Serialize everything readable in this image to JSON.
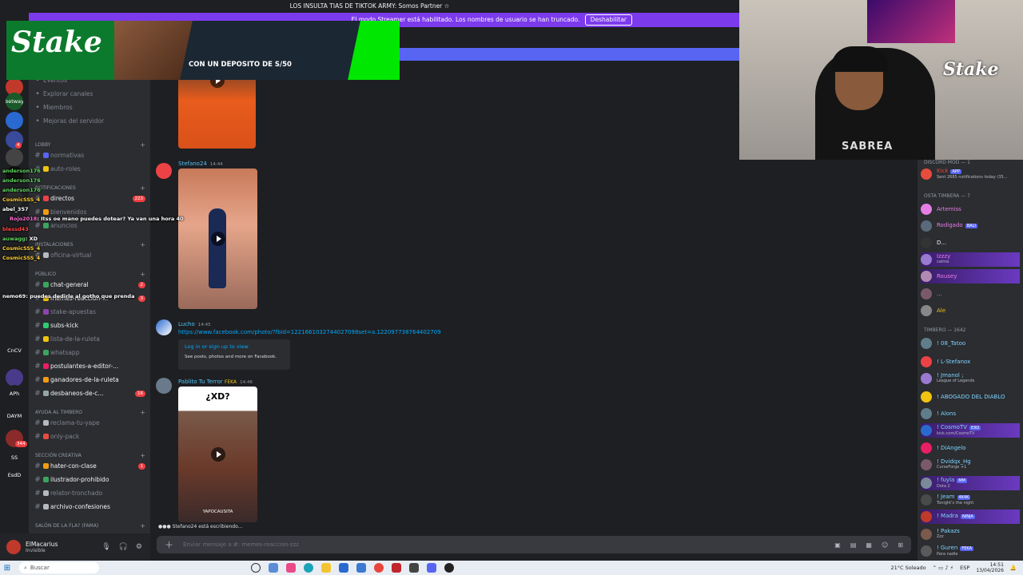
{
  "window": {
    "title": "LOS INSULTA TIAS DE TIKTOK ARMY: Somos Partner ☆"
  },
  "streamer_banner": {
    "text": "El modo Streamer está habilitado. Los nombres de usuario se han truncado.",
    "button": "Deshabilitar"
  },
  "ad": {
    "brand": "Stake",
    "promo": "CON UN DEPOSITO DE S/50"
  },
  "camera": {
    "brand": "Stake",
    "shirt": "SABREA"
  },
  "guilds": [
    {
      "label": "",
      "badge": ""
    },
    {
      "label": "betway",
      "badge": ""
    },
    {
      "label": "",
      "badge": ""
    },
    {
      "label": "",
      "badge": "4"
    },
    {
      "label": "",
      "badge": ""
    },
    {
      "label": "",
      "badge": ""
    },
    {
      "label": "",
      "badge": ""
    },
    {
      "label": "CnCV",
      "badge": ""
    },
    {
      "label": "",
      "badge": ""
    },
    {
      "label": "APh",
      "badge": ""
    },
    {
      "label": "DAYM",
      "badge": ""
    },
    {
      "label": "",
      "badge": "344"
    },
    {
      "label": "SS",
      "badge": ""
    },
    {
      "label": "EsdD",
      "badge": ""
    }
  ],
  "sidebar": {
    "top_items": [
      "Eventos",
      "Explorar canales",
      "Miembros",
      "Mejoras del servidor"
    ],
    "categories": {
      "lobby": "LOBBY",
      "notificaciones": "NOTIFICACIONES",
      "instalaciones": "INSTALACIONES",
      "publico": "PÚBLICO",
      "ayuda": "AYUDA AL TIMBERO",
      "creativa": "SECCIÓN CREATIVA",
      "salon": "SALÓN DE LA FLA? (FAMA)"
    },
    "channels": [
      {
        "name": "normativas",
        "bold": false,
        "badge": ""
      },
      {
        "name": "auto-roles",
        "bold": false,
        "badge": ""
      },
      {
        "name": "directos",
        "bold": true,
        "badge": "223"
      },
      {
        "name": "bienvenidos",
        "bold": false,
        "badge": ""
      },
      {
        "name": "anuncios",
        "bold": false,
        "badge": ""
      },
      {
        "name": "oficina-virtual",
        "bold": false,
        "badge": ""
      },
      {
        "name": "chat-general",
        "bold": true,
        "badge": "2"
      },
      {
        "name": "memes-reaccion-...",
        "bold": true,
        "badge": "3"
      },
      {
        "name": "stake-apuestas",
        "bold": false,
        "badge": ""
      },
      {
        "name": "subs-kick",
        "bold": true,
        "badge": ""
      },
      {
        "name": "lista-de-la-ruleta",
        "bold": false,
        "badge": ""
      },
      {
        "name": "whatsapp",
        "bold": false,
        "badge": ""
      },
      {
        "name": "postulantes-a-editor-...",
        "bold": true,
        "badge": ""
      },
      {
        "name": "ganadores-de-la-ruleta",
        "bold": true,
        "badge": ""
      },
      {
        "name": "desbaneos-de-c...",
        "bold": true,
        "badge": "16"
      },
      {
        "name": "reclama-tu-yape",
        "bold": false,
        "badge": ""
      },
      {
        "name": "only-pack",
        "bold": false,
        "badge": ""
      },
      {
        "name": "hater-con-clase",
        "bold": true,
        "badge": "1"
      },
      {
        "name": "ilustrador-prohibido",
        "bold": true,
        "badge": ""
      },
      {
        "name": "relator-tronchado",
        "bold": false,
        "badge": ""
      },
      {
        "name": "archivo-confesiones",
        "bold": true,
        "badge": ""
      }
    ]
  },
  "chat_overlay": [
    {
      "user": "anderson176",
      "text": "",
      "color": "#5fd35f"
    },
    {
      "user": "anderson176",
      "text": "",
      "color": "#5fd35f"
    },
    {
      "user": "anderson176",
      "text": "",
      "color": "#5fd35f"
    },
    {
      "user": "CosmicSSS_4",
      "text": "",
      "color": "#ffcc33"
    },
    {
      "user": "abel_357",
      "text": "",
      "color": "#ffffff"
    },
    {
      "user": "Rojo2018",
      "text": "Itss oe mano puedes dotear? Ya van una hora 40",
      "color": "#ff6bd6"
    },
    {
      "user": "blessd43",
      "text": "",
      "color": "#ff4444"
    },
    {
      "user": "auwagg",
      "text": "XD",
      "color": "#5fd35f"
    },
    {
      "user": "CosmicSSS_4",
      "text": "",
      "color": "#ffcc33"
    },
    {
      "user": "CosmicSSS_4",
      "text": "",
      "color": "#ffcc33"
    },
    {
      "user": "nemo69",
      "text": "puedes dedirle al gotho que prenda",
      "color": "#ffffff"
    }
  ],
  "user": {
    "name": "ElMacarius",
    "status": "Invisible"
  },
  "messages": [
    {
      "author": "Stefano24",
      "time": "14:44",
      "color": "#4fc3f7"
    },
    {
      "author": "Lucho",
      "time": "14:45",
      "color": "#4fc3f7",
      "link": "https://www.facebook.com/photo/?fbid=1221661032744027098set=a.122097738764402709",
      "embed_title": "Log in or sign up to view",
      "embed_desc": "See posts, photos and more on Facebook."
    },
    {
      "author": "Pablito Tu Terror",
      "time": "14:46",
      "color": "#4fc3f7",
      "tag": "FEKA",
      "thumb_text": "¿XD?",
      "watermark": "YAPOCAUSITA"
    }
  ],
  "typing": "Stefano24 está escribiendo...",
  "composer": {
    "placeholder": "Enviar mensaje a #: memes-reaccion-zzz"
  },
  "members": {
    "categories": [
      "DISCORD MOD — 1",
      "OSTA TIMBERA — 7",
      "TIMBERO — 1642"
    ],
    "list": [
      {
        "name": "Kick",
        "sub": "Sent 2685 notifications today (35...",
        "color": "#e74c3c",
        "tag": "APP",
        "hl": false
      },
      {
        "name": "Artemiss",
        "sub": "",
        "color": "#e67ee6",
        "tag": "",
        "hl": false
      },
      {
        "name": "Rodigado",
        "sub": "",
        "color": "#e67ee6",
        "tag": "BALI",
        "hl": false
      },
      {
        "name": "D...",
        "sub": "",
        "color": "#f2f3f5",
        "tag": "",
        "hl": false
      },
      {
        "name": "Izzzy",
        "sub": "calma",
        "color": "#e67ee6",
        "tag": "",
        "hl": true
      },
      {
        "name": "Rousey",
        "sub": "",
        "color": "#e67ee6",
        "tag": "",
        "hl": true
      },
      {
        "name": "...",
        "sub": "",
        "color": "#e67ee6",
        "tag": "",
        "hl": false
      },
      {
        "name": "Ale",
        "sub": "",
        "color": "#f1c40f",
        "tag": "",
        "hl": false
      },
      {
        "name": "! 08_Tatoo",
        "sub": "",
        "color": "#7fd4ff",
        "tag": "",
        "hl": false
      },
      {
        "name": "! L-Stefanox",
        "sub": "",
        "color": "#7fd4ff",
        "tag": "",
        "hl": false
      },
      {
        "name": "! Jmanol ;",
        "sub": "League of Legends",
        "color": "#7fd4ff",
        "tag": "",
        "hl": false
      },
      {
        "name": "! ABOGADO DEL DIABLO",
        "sub": "",
        "color": "#7fd4ff",
        "tag": "",
        "hl": false
      },
      {
        "name": "! Alons",
        "sub": "",
        "color": "#7fd4ff",
        "tag": "",
        "hl": false
      },
      {
        "name": "! CosmoTV",
        "sub": "kick.com/CosmoTV",
        "color": "#7fd4ff",
        "tag": "EXO",
        "hl": true
      },
      {
        "name": "! DiAngelo",
        "sub": "",
        "color": "#7fd4ff",
        "tag": "",
        "hl": false
      },
      {
        "name": "! Dvidqx_Hg",
        "sub": "CurseForge +1",
        "color": "#7fd4ff",
        "tag": "",
        "hl": false
      },
      {
        "name": "! fuyla",
        "sub": "Dota 2",
        "color": "#7fd4ff",
        "tag": "MM",
        "hl": true
      },
      {
        "name": "! Jeam",
        "sub": "Tonight's the night",
        "color": "#7fd4ff",
        "tag": "4K4K",
        "hl": false
      },
      {
        "name": "! Madra",
        "sub": "",
        "color": "#7fd4ff",
        "tag": "NINJA",
        "hl": true
      },
      {
        "name": "! Pakazs",
        "sub": "Zzz",
        "color": "#7fd4ff",
        "tag": "",
        "hl": false
      },
      {
        "name": "! Guren",
        "sub": "Para nadie",
        "color": "#7fd4ff",
        "tag": "FEKA",
        "hl": false
      }
    ]
  },
  "taskbar": {
    "search": "Buscar",
    "weather": "21°C Soleado",
    "lang": "ESP",
    "time": "14:51",
    "date": "13/04/2026"
  },
  "colors": {
    "blurple": "#5865f2",
    "streamer": "#7c3aed",
    "stake_green": "#00e701"
  }
}
